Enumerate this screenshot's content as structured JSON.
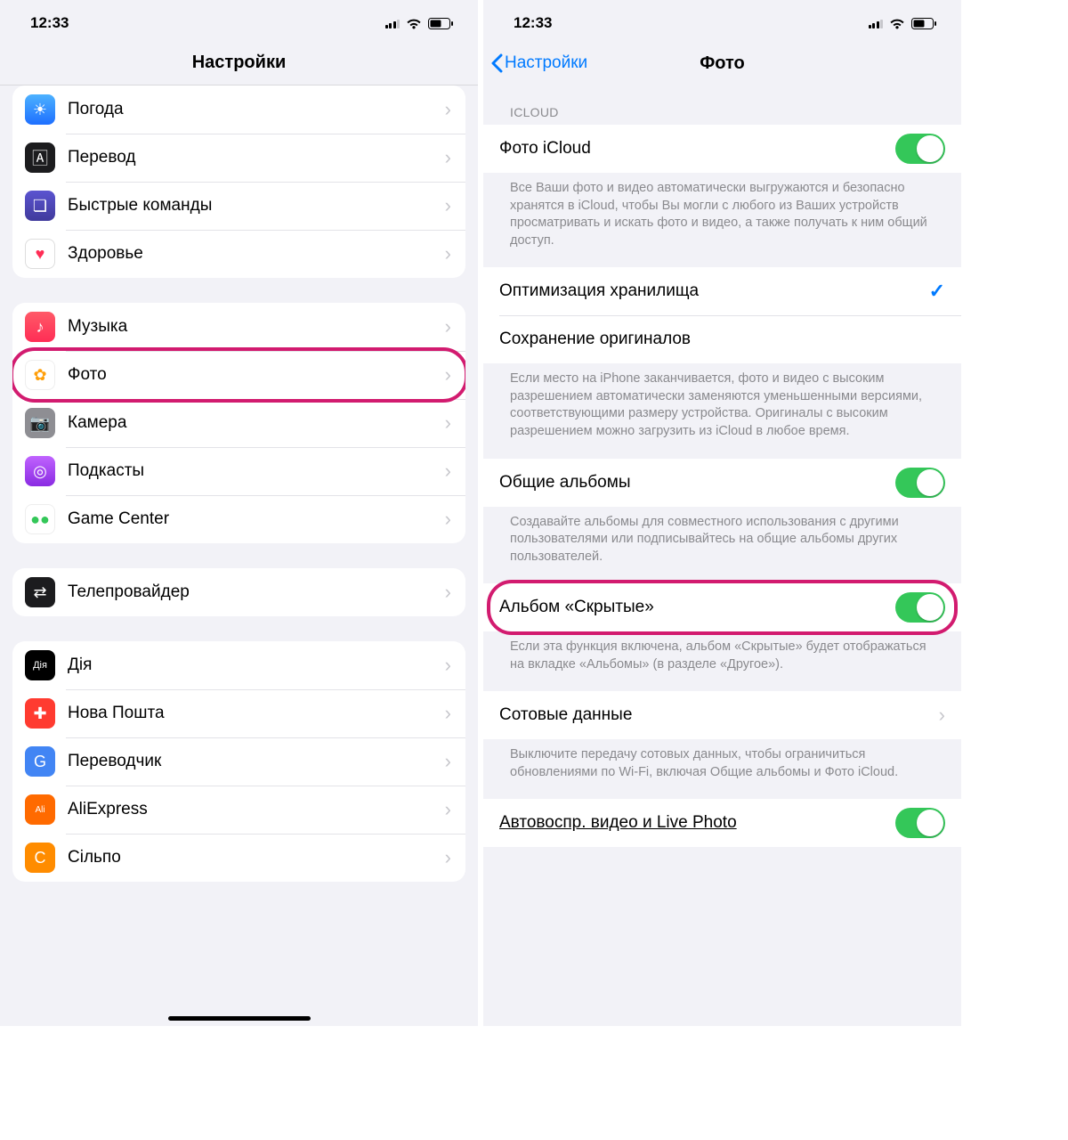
{
  "status": {
    "time": "12:33"
  },
  "left": {
    "title": "Настройки",
    "group1": [
      {
        "label": "Погода",
        "icon_bg": "linear-gradient(#4db2ff,#1e6fff)",
        "glyph": "☀"
      },
      {
        "label": "Перевод",
        "icon_bg": "#1c1c1e",
        "glyph": "🄰"
      },
      {
        "label": "Быстрые команды",
        "icon_bg": "linear-gradient(#5b54d0,#403a9c)",
        "glyph": "❏"
      },
      {
        "label": "Здоровье",
        "icon_bg": "#ffffff",
        "glyph": "♥",
        "glyph_color": "#ff2d55",
        "border": "1px solid #ddd"
      }
    ],
    "group2": [
      {
        "label": "Музыка",
        "icon_bg": "linear-gradient(#ff5a68,#ff2d55)",
        "glyph": "♪"
      },
      {
        "label": "Фото",
        "icon_bg": "#ffffff",
        "glyph": "✿",
        "glyph_color": "#ff9f0a",
        "border": "1px solid #eee"
      },
      {
        "label": "Камера",
        "icon_bg": "#8e8e93",
        "glyph": "📷"
      },
      {
        "label": "Подкасты",
        "icon_bg": "linear-gradient(#c063ff,#8a2be2)",
        "glyph": "◎"
      },
      {
        "label": "Game Center",
        "icon_bg": "#ffffff",
        "glyph": "●●",
        "glyph_color": "#34c759",
        "border": "1px solid #eee"
      }
    ],
    "group3": [
      {
        "label": "Телепровайдер",
        "icon_bg": "#1c1c1e",
        "glyph": "⇄"
      }
    ],
    "group4": [
      {
        "label": "Дія",
        "icon_bg": "#000000",
        "glyph": "Дія",
        "font_size": "11px"
      },
      {
        "label": "Нова Пошта",
        "icon_bg": "#ff3b30",
        "glyph": "✚"
      },
      {
        "label": "Переводчик",
        "icon_bg": "#4285f4",
        "glyph": "G"
      },
      {
        "label": "AliExpress",
        "icon_bg": "#ff6a00",
        "glyph": "Ali",
        "font_size": "10px"
      },
      {
        "label": "Сільпо",
        "icon_bg": "#ff8c00",
        "glyph": "С"
      }
    ]
  },
  "right": {
    "back_label": "Настройки",
    "title": "Фото",
    "icloud_header": "ICLOUD",
    "rows": {
      "icloud_photos": "Фото iCloud",
      "icloud_footer": "Все Ваши фото и видео автоматически выгружаются и безопасно хранятся в iCloud, чтобы Вы могли с любого из Ваших устройств просматривать и искать фото и видео, а также получать к ним общий доступ.",
      "optimize": "Оптимизация хранилища",
      "download": "Сохранение оригиналов",
      "storage_footer": "Если место на iPhone заканчивается, фото и видео с высоким разрешением автоматически заменяются уменьшенными версиями, соответствующими размеру устройства. Оригиналы с высоким разрешением можно загрузить из iCloud в любое время.",
      "shared_albums": "Общие альбомы",
      "shared_footer": "Создавайте альбомы для совместного использования с другими пользователями или подписывайтесь на общие альбомы других пользователей.",
      "hidden_album": "Альбом «Скрытые»",
      "hidden_footer": "Если эта функция включена, альбом «Скрытые» будет отображаться на вкладке «Альбомы» (в разделе «Другое»).",
      "cellular": "Сотовые данные",
      "cellular_footer": "Выключите передачу сотовых данных, чтобы ограничиться обновлениями по Wi-Fi, включая Общие альбомы и Фото iCloud.",
      "autoplay": "Автовоспр. видео и Live Photo"
    }
  }
}
